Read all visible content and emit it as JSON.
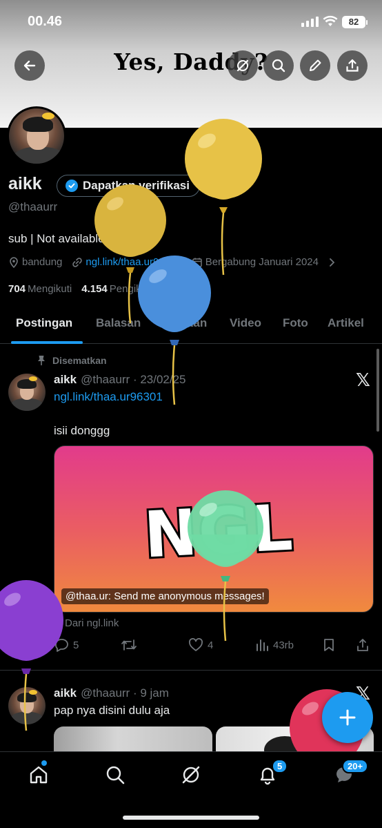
{
  "status": {
    "time": "00.46",
    "battery": "82"
  },
  "banner": {
    "title": "Yes, Daddy?"
  },
  "profile": {
    "name": "aikk",
    "verify_label": "Dapatkan verifikasi",
    "handle": "@thaaurr",
    "bio": "sub | Not available",
    "location": "bandung",
    "link": "ngl.link/thaa.ur96301",
    "joined": "Bergabung Januari 2024",
    "following_count": "704",
    "following_label": "Mengikuti",
    "followers_count": "4.154",
    "followers_label": "Pengikut"
  },
  "tabs": [
    {
      "label": "Postingan"
    },
    {
      "label": "Balasan"
    },
    {
      "label": "Sorotan"
    },
    {
      "label": "Video"
    },
    {
      "label": "Foto"
    },
    {
      "label": "Artikel"
    }
  ],
  "post1": {
    "pinned_label": "Disematkan",
    "name": "aikk",
    "meta": "@thaaurr · 23/02/25",
    "link": "ngl.link/thaa.ur96301",
    "text": "isii donggg",
    "card_word": "NGL",
    "card_caption": "@thaa.ur: Send me anonymous messages!",
    "source": "Dari ngl.link",
    "replies": "5",
    "likes": "4",
    "views": "43rb"
  },
  "post2": {
    "name": "aikk",
    "meta": "@thaaurr · 9 jam",
    "text": "pap nya disini dulu aja"
  },
  "nav": {
    "notifications_badge": "5",
    "messages_badge": "20+"
  },
  "colors": {
    "accent": "#1d9bf0",
    "balloon_yellow": "#e7c247",
    "balloon_blue": "#4a8fdc",
    "balloon_green": "#6fdba4",
    "balloon_purple": "#8a3fd1",
    "balloon_pink": "#e0345a"
  }
}
